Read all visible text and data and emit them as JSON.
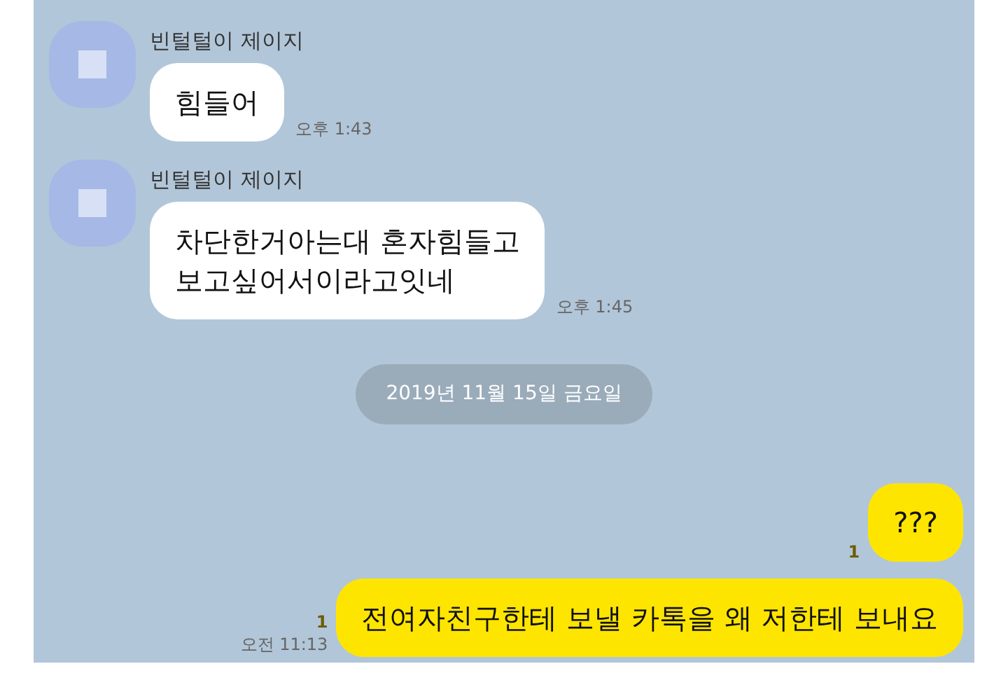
{
  "messages": [
    {
      "kind": "received",
      "sender": "빈털털이 제이지",
      "lines": [
        "힘들어"
      ],
      "time": "오후 1:43"
    },
    {
      "kind": "received",
      "sender": "빈털털이 제이지",
      "lines": [
        "차단한거아는대 혼자힘들고",
        "보고싶어서이라고잇네"
      ],
      "time": "오후 1:45"
    },
    {
      "kind": "date",
      "text": "2019년 11월 15일 금요일"
    },
    {
      "kind": "sent",
      "lines": [
        "???"
      ],
      "unread": "1"
    },
    {
      "kind": "sent",
      "lines": [
        "전여자친구한테 보낼 카톡을 왜 저한테 보내요"
      ],
      "unread": "1",
      "time": "오전 11:13"
    }
  ]
}
